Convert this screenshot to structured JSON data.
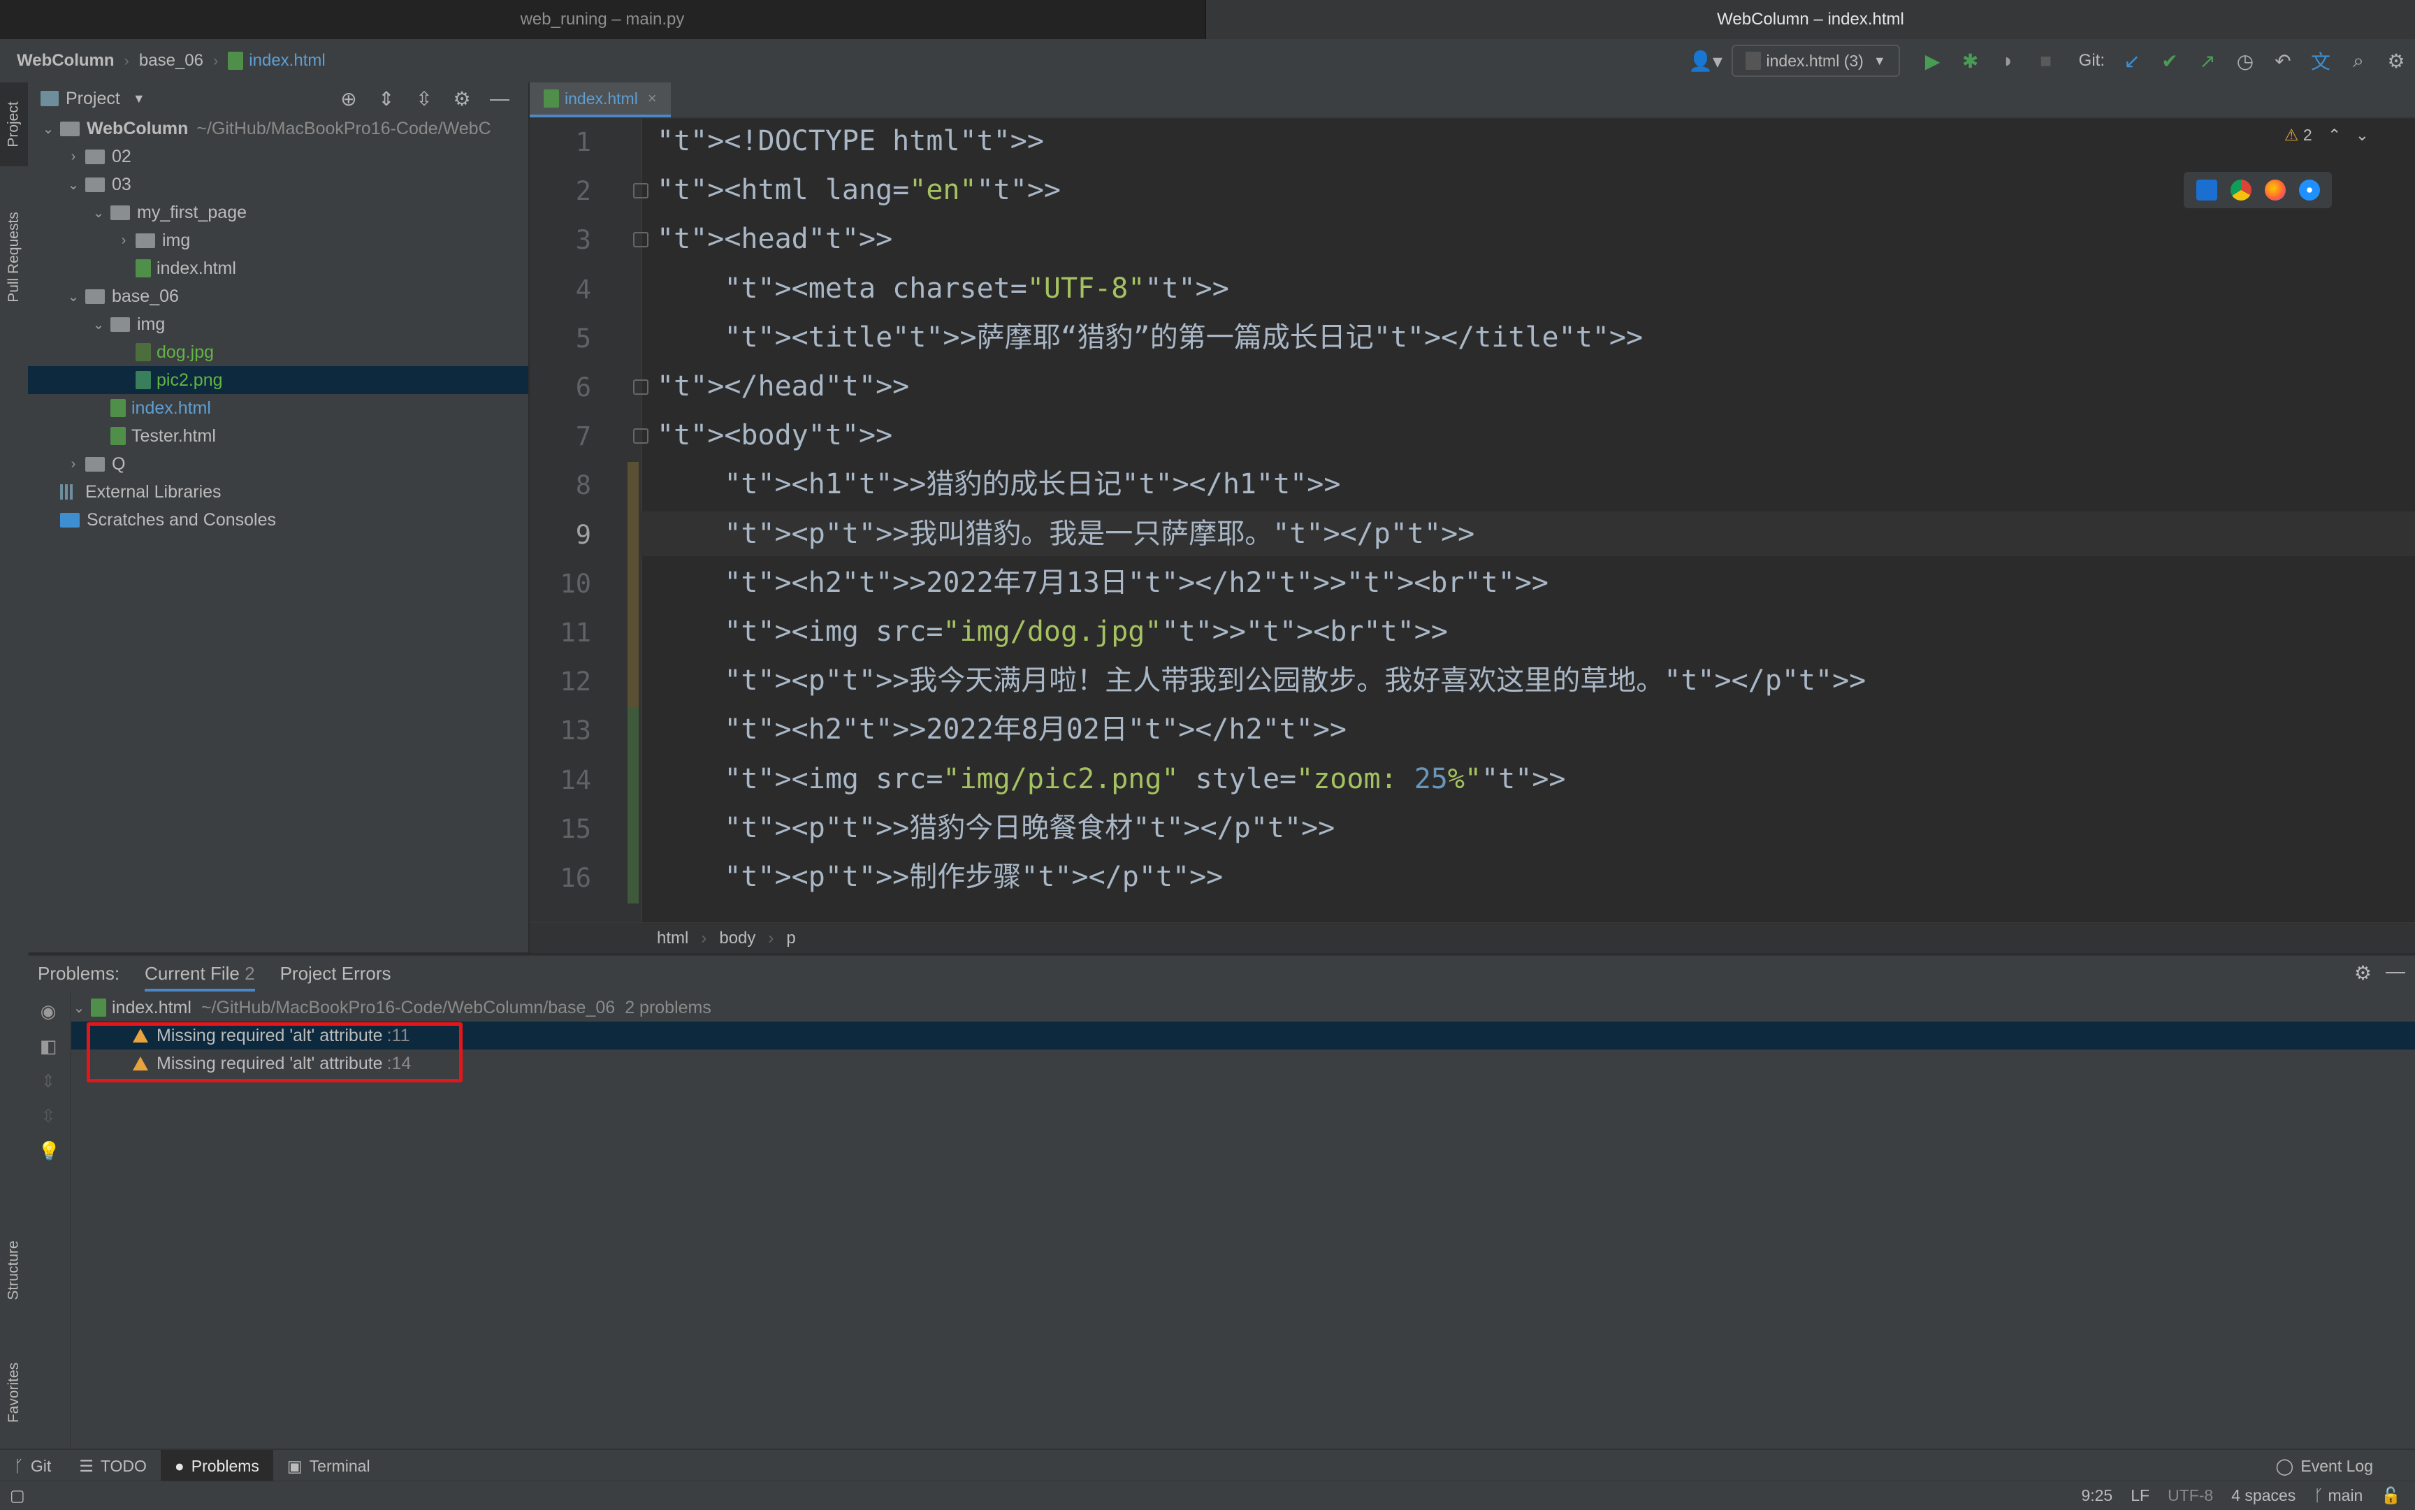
{
  "windows": {
    "left_title": "web_runing – main.py",
    "right_title": "WebColumn – index.html"
  },
  "navbar": {
    "breadcrumb": [
      "WebColumn",
      "base_06",
      "index.html"
    ],
    "run_config": "index.html (3)",
    "git_label": "Git:"
  },
  "left_stripe": {
    "project": "Project",
    "pull_requests": "Pull Requests",
    "structure": "Structure",
    "favorites": "Favorites"
  },
  "project_panel": {
    "title": "Project",
    "tree": [
      {
        "label": "WebColumn",
        "extra": "~/GitHub/MacBookPro16-Code/WebC",
        "level": 0,
        "arrow": "open",
        "kind": "folder"
      },
      {
        "label": "02",
        "level": 1,
        "arrow": "closed",
        "kind": "folder"
      },
      {
        "label": "03",
        "level": 1,
        "arrow": "open",
        "kind": "folder"
      },
      {
        "label": "my_first_page",
        "level": 2,
        "arrow": "open",
        "kind": "folder"
      },
      {
        "label": "img",
        "level": 3,
        "arrow": "closed",
        "kind": "folder"
      },
      {
        "label": "index.html",
        "level": 3,
        "arrow": "none",
        "kind": "html"
      },
      {
        "label": "base_06",
        "level": 1,
        "arrow": "open",
        "kind": "folder"
      },
      {
        "label": "img",
        "level": 2,
        "arrow": "open",
        "kind": "folder"
      },
      {
        "label": "dog.jpg",
        "level": 3,
        "arrow": "none",
        "kind": "jpg"
      },
      {
        "label": "pic2.png",
        "level": 3,
        "arrow": "none",
        "kind": "png"
      },
      {
        "label": "index.html",
        "level": 2,
        "arrow": "none",
        "kind": "html"
      },
      {
        "label": "Tester.html",
        "level": 2,
        "arrow": "none",
        "kind": "html"
      },
      {
        "label": "Q",
        "level": 1,
        "arrow": "closed",
        "kind": "folder"
      },
      {
        "label": "External Libraries",
        "level": 0,
        "arrow": "none",
        "kind": "lib"
      },
      {
        "label": "Scratches and Consoles",
        "level": 0,
        "arrow": "none",
        "kind": "scratch"
      }
    ]
  },
  "editor": {
    "tab": "index.html",
    "warning_count": "2",
    "current_line": 9,
    "line_numbers": [
      "1",
      "2",
      "3",
      "4",
      "5",
      "6",
      "7",
      "8",
      "9",
      "10",
      "11",
      "12",
      "13",
      "14",
      "15",
      "16"
    ],
    "lines": [
      "<!DOCTYPE html>",
      "<html lang=\"en\">",
      "<head>",
      "    <meta charset=\"UTF-8\">",
      "    <title>萨摩耶“猎豹”的第一篇成长日记</title>",
      "</head>",
      "<body>",
      "    <h1>猎豹的成长日记</h1>",
      "    <p>我叫猎豹。我是一只萨摩耶。</p>",
      "    <h2>2022年7月13日</h2><br>",
      "    <img src=\"img/dog.jpg\"><br>",
      "    <p>我今天满月啦！主人带我到公园散步。我好喜欢这里的草地。</p>",
      "    <h2>2022年8月02日</h2>",
      "    <img src=\"img/pic2.png\" style=\"zoom: 25%\">",
      "    <p>猎豹今日晚餐食材</p>",
      "    <p>制作步骤</p>"
    ],
    "breadcrumbs": [
      "html",
      "body",
      "p"
    ]
  },
  "problems": {
    "label": "Problems:",
    "tabs": [
      {
        "label": "Current File",
        "count": "2"
      },
      {
        "label": "Project Errors",
        "count": ""
      }
    ],
    "file": {
      "name": "index.html",
      "path": "~/GitHub/MacBookPro16-Code/WebColumn/base_06",
      "summary": "2 problems"
    },
    "items": [
      {
        "message": "Missing required 'alt' attribute",
        "line": ":11"
      },
      {
        "message": "Missing required 'alt' attribute",
        "line": ":14"
      }
    ]
  },
  "bottom_tabs": {
    "git": "Git",
    "todo": "TODO",
    "problems": "Problems",
    "terminal": "Terminal",
    "event_log": "Event Log"
  },
  "status": {
    "position": "9:25",
    "line_sep": "LF",
    "encoding": "UTF-8",
    "indent": "4 spaces",
    "branch": "main"
  },
  "colors": {
    "accent": "#4a88c7",
    "warning": "#e8a33d",
    "highlight_box": "#e5161a",
    "tag": "#e8bf6a",
    "string": "#a5c261"
  }
}
